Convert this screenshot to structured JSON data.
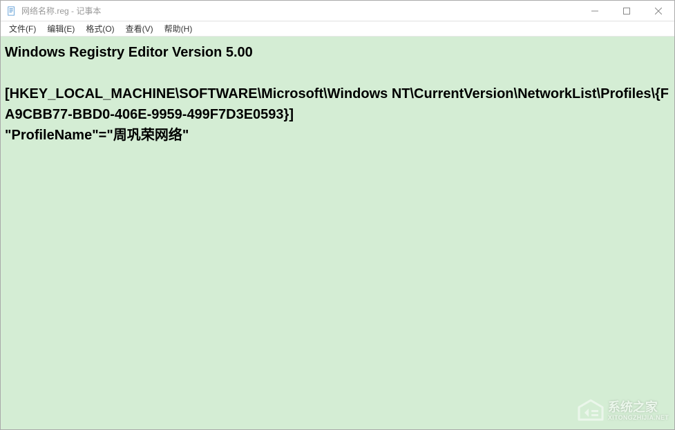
{
  "titlebar": {
    "title": "网络名称.reg - 记事本"
  },
  "menubar": {
    "items": [
      "文件(F)",
      "编辑(E)",
      "格式(O)",
      "查看(V)",
      "帮助(H)"
    ]
  },
  "editor": {
    "content": "Windows Registry Editor Version 5.00\n\n[HKEY_LOCAL_MACHINE\\SOFTWARE\\Microsoft\\Windows NT\\CurrentVersion\\NetworkList\\Profiles\\{FA9CBB77-BBD0-406E-9959-499F7D3E0593}]\n\"ProfileName\"=\"周巩荣网络\""
  },
  "watermark": {
    "main": "系统之家",
    "sub": "XITONGZHIJIA.NET"
  }
}
